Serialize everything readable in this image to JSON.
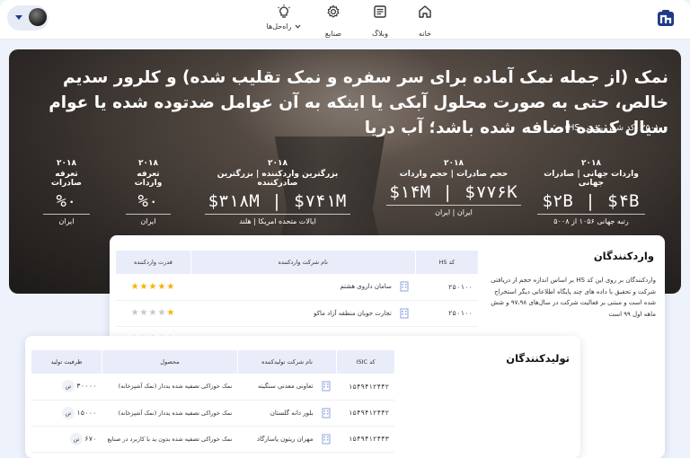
{
  "nav": {
    "home": "خانه",
    "blog": "وبلاگ",
    "industries": "صنایع",
    "solutions": "راه‌حل‌ها"
  },
  "hero": {
    "title": "نمک (از جمله نمک آماده برای سر سفره و نمک تقلیب شده) و کلرور سدیم خالص، حتی به صورت محلول آبکی یا اینکه به آن عوامل ضدتوده شده یا عوام سیال کننده اضافه شده باشد؛ آب دریا",
    "code": "۲۵۰۱۰۰ (کد شش رقمی HS)",
    "stats": [
      {
        "year": "۲۰۱۸",
        "title": "واردات جهانی | صادرات جهانی",
        "value": "$۲B | $۴B",
        "sub": "رتبه جهانی ۱۰۵۶ از ۵۰۰۸"
      },
      {
        "year": "۲۰۱۸",
        "title": "حجم صادرات | حجم واردات",
        "value": "$۱۴M | $۷۷۶K",
        "sub": "ایران | ایران"
      },
      {
        "year": "۲۰۱۸",
        "title": "بزرگترین واردکننده | بزرگترین صادرکننده",
        "value": "$۳۱۸M | $۷۴۱M",
        "sub": "ایالات متحده امریکا | هلند"
      },
      {
        "year": "۲۰۱۸",
        "title": "تعرفه واردات",
        "value": "%۰",
        "sub": "ایران"
      },
      {
        "year": "۲۰۱۸",
        "title": "تعرفه صادرات",
        "value": "%۰",
        "sub": "ایران"
      }
    ]
  },
  "importers": {
    "title": "واردکنندگان",
    "description": "واردکنندگان بر روی این کد HS بر اساس اندازه حجم از دریافتی شرکت و تحقیق با داده های چند پایگاه اطلاعاتی دیگر استخراج شده است و مبتنی بر فعالیت شرکت در سال‌های ۹۷،۹۸ و شش ماهه اول ۹۹ است",
    "headers": [
      "کد HS",
      "نام شرکت واردکننده",
      "قدرت واردکننده"
    ],
    "rows": [
      {
        "code": "۲۵۰۱۰۰",
        "name": "سامان داروی هشتم",
        "rating": 5
      },
      {
        "code": "۲۵۰۱۰۰",
        "name": "تجارت جویان منطقه آزاد ماکو",
        "rating": 1
      },
      {
        "code": "۲۵۰۱۰۰",
        "name": "",
        "rating": 3
      }
    ]
  },
  "producers": {
    "title": "تولیدکنندگان",
    "headers": [
      "کد ISIC",
      "نام شرکت تولیدکننده",
      "محصول",
      "ظرفیت تولید"
    ],
    "rows": [
      {
        "code": "۱۵۴۹۴۱۲۴۴۲",
        "name": "تعاونی معدنی سنگینه",
        "product": "نمک خوراکی تصفیه شده یددار (نمک آشپزخانه)",
        "capacity": "۳۰۰۰۰",
        "unit": "تن"
      },
      {
        "code": "۱۵۴۹۴۱۲۴۴۲",
        "name": "بلور دانه گلستان",
        "product": "نمک خوراکی تصفیه شده یددار (نمک آشپزخانه)",
        "capacity": "۱۵۰۰۰",
        "unit": "تن"
      },
      {
        "code": "۱۵۴۹۴۱۲۴۴۳",
        "name": "مهران ریتون پاسارگاد",
        "product": "نمک خوراکی تصفیه شده بدون ید با کاربرد در صنایع",
        "capacity": "۶۷۰",
        "unit": "تن"
      }
    ]
  },
  "colors": {
    "brand": "#1f3a8a",
    "star": "#f4b400",
    "header_bg": "#e9edfa"
  }
}
